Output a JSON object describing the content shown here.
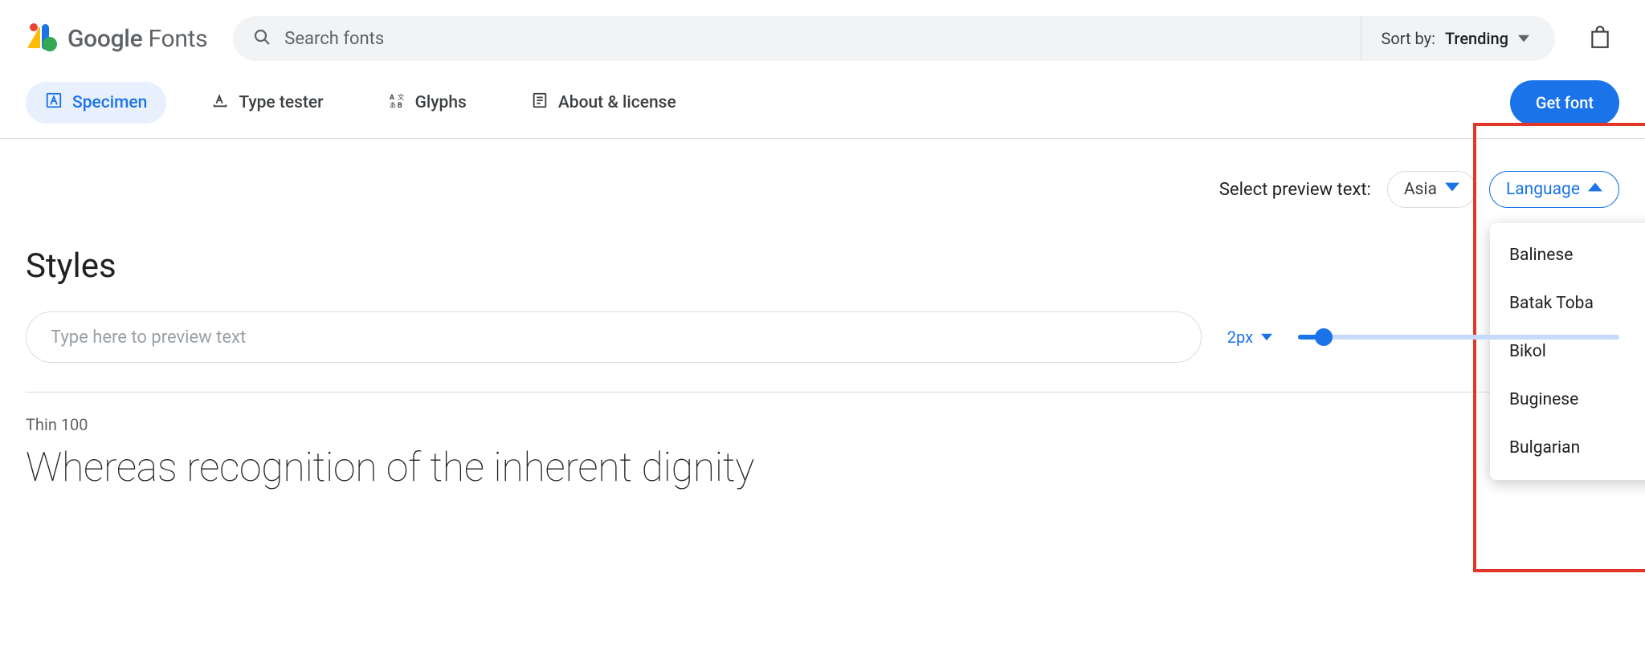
{
  "brand": {
    "word1": "Google",
    "word2": " Fonts"
  },
  "search": {
    "placeholder": "Search fonts"
  },
  "sort": {
    "label": "Sort by: ",
    "value": "Trending"
  },
  "tabs": {
    "specimen": "Specimen",
    "type_tester": "Type tester",
    "glyphs": "Glyphs",
    "about": "About & license"
  },
  "cta": "Get font",
  "preview_select": {
    "label": "Select preview text:",
    "region_chip": "Asia",
    "language_chip": "Language",
    "language_options": [
      "Balinese",
      "Batak Toba",
      "Bikol",
      "Buginese",
      "Bulgarian"
    ]
  },
  "styles_heading": "Styles",
  "preview_input": {
    "placeholder": "Type here to preview text"
  },
  "size_selector": {
    "value": "2px"
  },
  "style_sample": {
    "name": "Thin 100",
    "text": "Whereas recognition of the inherent dignity"
  },
  "colors": {
    "accent": "#1a73e8",
    "highlight": "#e3362b"
  }
}
